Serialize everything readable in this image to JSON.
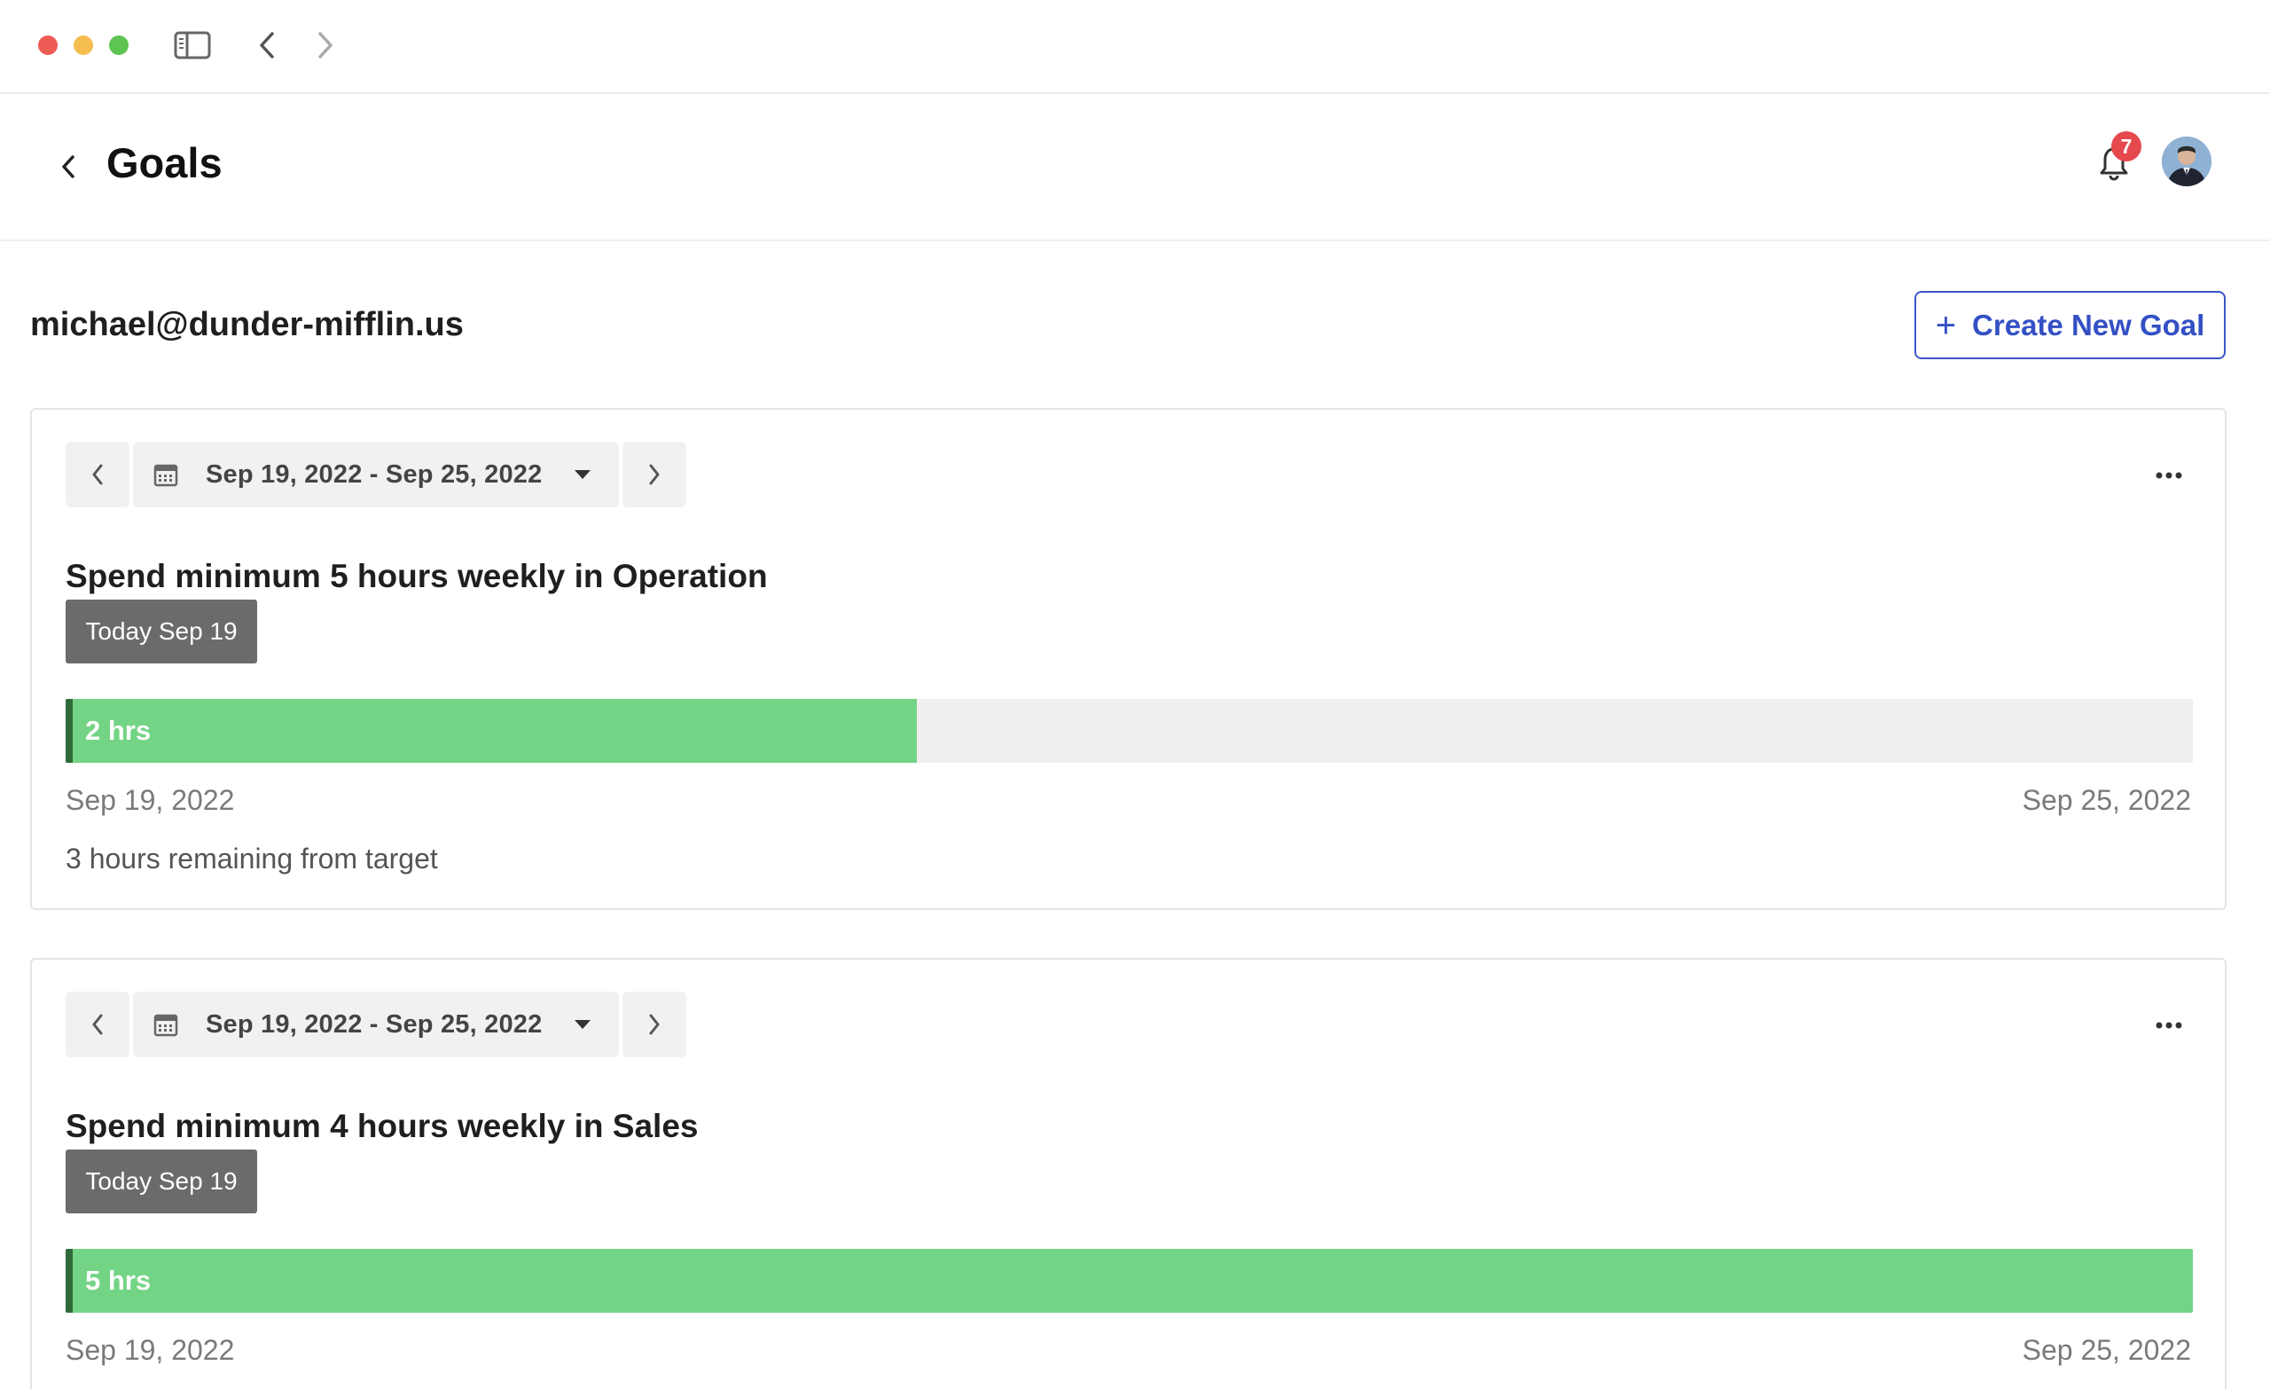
{
  "header": {
    "title": "Goals",
    "notification_count": "7"
  },
  "user": {
    "email": "michael@dunder-mifflin.us"
  },
  "actions": {
    "create_label": "Create New Goal"
  },
  "goals": [
    {
      "date_range": "Sep 19, 2022 - Sep 25, 2022",
      "title": "Spend minimum 5 hours weekly in Operation",
      "today_label": "Today Sep 19",
      "progress_label": "2 hrs",
      "progress_fraction": 0.4,
      "start_date": "Sep 19, 2022",
      "end_date": "Sep 25, 2022",
      "remaining": "3 hours remaining from target"
    },
    {
      "date_range": "Sep 19, 2022 - Sep 25, 2022",
      "title": "Spend minimum 4 hours weekly in Sales",
      "today_label": "Today Sep 19",
      "progress_label": "5 hrs",
      "progress_fraction": 1.0,
      "start_date": "Sep 19, 2022",
      "end_date": "Sep 25, 2022",
      "remaining": ""
    }
  ],
  "colors": {
    "accent": "#3450c4",
    "progress_fill": "#74d485",
    "progress_track": "#efefef",
    "badge": "#e5484d"
  },
  "icons": {
    "titlebar": [
      "close-window-icon",
      "minimize-window-icon",
      "zoom-window-icon",
      "sidebar-toggle-icon",
      "chevron-left-icon",
      "chevron-right-icon"
    ],
    "header": [
      "chevron-left-icon",
      "bell-icon",
      "avatar"
    ],
    "card": [
      "chevron-left-icon",
      "calendar-icon",
      "caret-down-icon",
      "chevron-right-icon",
      "more-horizontal-icon"
    ]
  }
}
